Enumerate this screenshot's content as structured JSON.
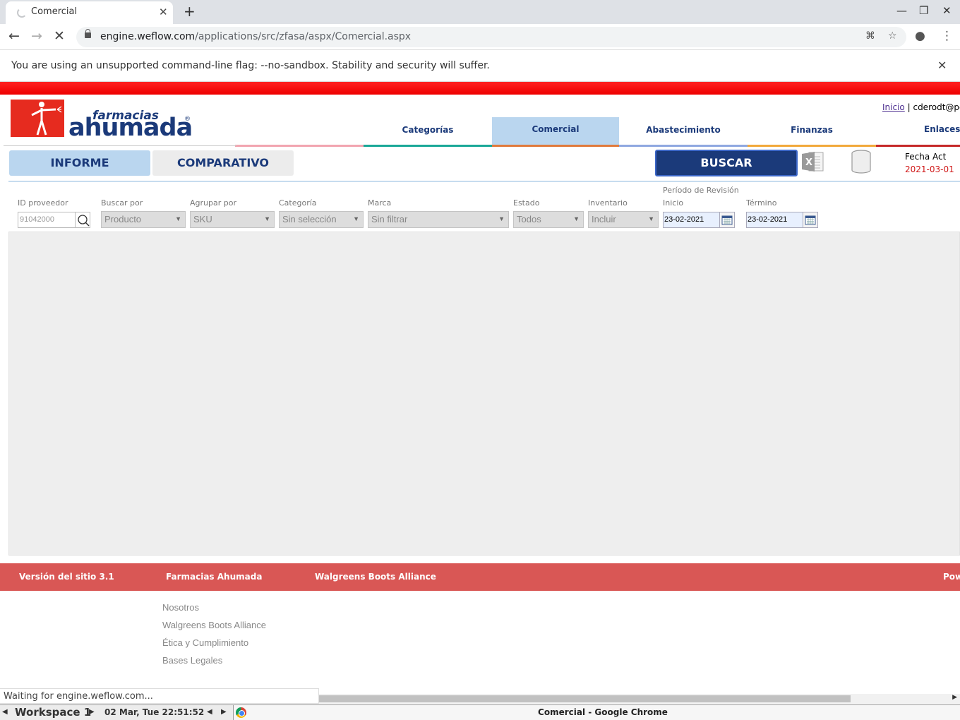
{
  "browser": {
    "tab_title": "Comercial",
    "url_host": "engine.weflow.com",
    "url_path": "/applications/src/zfasa/aspx/Comercial.aspx",
    "infobar_message": "You are using an unsupported command-line flag: --no-sandbox. Stability and security will suffer.",
    "status_text": "Waiting for engine.weflow.com..."
  },
  "header": {
    "logo_small": "farmacias",
    "logo_big": "ahumada",
    "logo_reg": "®",
    "user_link": "Inicio",
    "user_sep": "|",
    "user_name": "cderodt@petr"
  },
  "nav": [
    {
      "label": "Categorías",
      "active": false,
      "color": "#1aa898"
    },
    {
      "label": "Comercial",
      "active": true,
      "color": "#e07a3c"
    },
    {
      "label": "Abastecimiento",
      "active": false,
      "color": "#8fa8e0"
    },
    {
      "label": "Finanzas",
      "active": false,
      "color": "#f2a93b"
    },
    {
      "label": "Enlaces",
      "active": false,
      "color": "#c62828"
    }
  ],
  "toolbar": {
    "tab_informe": "INFORME",
    "tab_comparativo": "COMPARATIVO",
    "buscar_label": "BUSCAR",
    "fecha_label": "Fecha Act",
    "fecha_value": "2021-03-01"
  },
  "filters": {
    "id_label": "ID proveedor",
    "id_value": "91042000",
    "buscar_por_label": "Buscar por",
    "buscar_por_value": "Producto",
    "agrupar_label": "Agrupar por",
    "agrupar_value": "SKU",
    "categoria_label": "Categoría",
    "categoria_value": "Sin selección",
    "marca_label": "Marca",
    "marca_value": "Sin filtrar",
    "estado_label": "Estado",
    "estado_value": "Todos",
    "inventario_label": "Inventario",
    "inventario_value": "Incluir",
    "periodo_label": "Período de Revisión",
    "inicio_label": "Inicio",
    "inicio_value": "23-02-2021",
    "termino_label": "Término",
    "termino_value": "23-02-2021"
  },
  "footer": {
    "version": "Versión del sitio 3.1",
    "col1": "Farmacias Ahumada",
    "col2": "Walgreens Boots Alliance",
    "col3": "Pow",
    "links": [
      "Nosotros",
      "Walgreens Boots Alliance",
      "Ética y Cumplimiento",
      "Bases Legales"
    ]
  },
  "taskbar": {
    "workspace": "Workspace 1",
    "clock": "02 Mar, Tue 22:51:52",
    "task_title": "Comercial - Google Chrome"
  }
}
